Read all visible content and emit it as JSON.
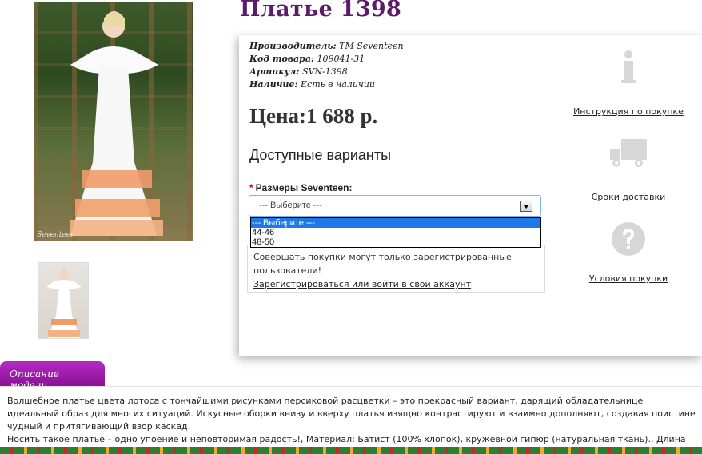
{
  "product": {
    "title": "Платье 1398",
    "specs": [
      {
        "label": "Производитель:",
        "value": "TM Seventeen"
      },
      {
        "label": "Код товара:",
        "value": "109041-31"
      },
      {
        "label": "Артикул:",
        "value": "SVN-1398"
      },
      {
        "label": "Наличие:",
        "value": "Есть в наличии"
      }
    ],
    "price": "Цена:1 688 р.",
    "variants_heading": "Доступные варианты",
    "size_label": "Размеры Seventeen:",
    "required_mark": "*",
    "select_value": "--- Выберите ---",
    "options": [
      "--- Выберите ---",
      "44-46",
      "48-50"
    ],
    "notice_text": "Совершать покупки могут только зарегистрированные пользователи!",
    "notice_link": "Зарегистрироваться или войти в свой аккаунт",
    "image_watermark": "Seventeen"
  },
  "sidebar": {
    "links": [
      {
        "icon": "info-icon",
        "label": "Инструкция по покупке"
      },
      {
        "icon": "truck-icon",
        "label": "Сроки доставки"
      },
      {
        "icon": "question-icon",
        "label": "Условия покупки"
      }
    ]
  },
  "description": {
    "tab_label": "Описание модели",
    "paragraph1": "Волшебное платье цвета лотоса с тончайшими рисунками персиковой расцветки – это прекрасный вариант, дарящий обладательнице идеальный образ для многих ситуаций. Искусные оборки внизу и вверху платья изящно контрастируют и взаимно дополняют, создавая поистине чудный и притягивающий взор каскад.",
    "paragraph2": "Носить такое платье – одно упоение и неповторимая радость!, Материал: Батист (100% хлопок), кружевной гипюр (натуральная ткань)., Длина изделия без"
  },
  "colors": {
    "title": "#5b1a6a",
    "tab": "#a01fb0",
    "select_highlight": "#1e78e6"
  }
}
